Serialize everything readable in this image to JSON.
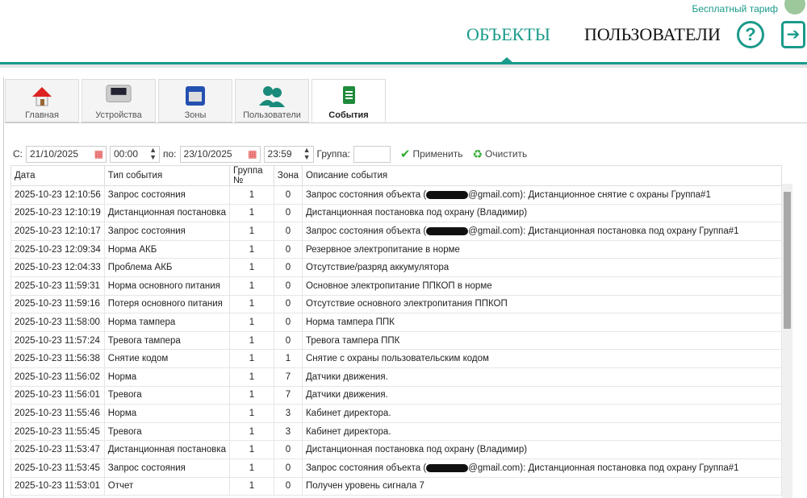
{
  "header": {
    "plan": "Бесплатный тариф",
    "nav": [
      "ОБЪЕКТЫ",
      "ПОЛЬЗОВАТЕЛИ"
    ],
    "active_nav": "ОБЪЕКТЫ",
    "accent": "#1a9a8a"
  },
  "tabs": [
    {
      "label": "Главная",
      "icon": "house-icon"
    },
    {
      "label": "Устройства",
      "icon": "device-panel-icon"
    },
    {
      "label": "Зоны",
      "icon": "zones-icon"
    },
    {
      "label": "Пользователи",
      "icon": "users-icon"
    },
    {
      "label": "События",
      "icon": "document-icon",
      "active": true
    }
  ],
  "filters": {
    "from_label": "С:",
    "from_date": "21/10/2025",
    "from_time": "00:00",
    "to_label": "по:",
    "to_date": "23/10/2025",
    "to_time": "23:59",
    "group_label": "Группа:",
    "group_value": "",
    "apply": "Применить",
    "clear": "Очистить"
  },
  "table": {
    "columns": [
      "Дата",
      "Тип события",
      "Группа №",
      "Зона",
      "Описание события"
    ],
    "rows": [
      [
        "2025-10-23 12:10:56",
        "Запрос состояния",
        "1",
        "0",
        "Запрос состояния объекта (",
        "@gmail.com): Дистанционное снятие с охраны Группа#1"
      ],
      [
        "2025-10-23 12:10:19",
        "Дистанционная постановка",
        "1",
        "0",
        "Дистанционная постановка под охрану (Владимир)",
        ""
      ],
      [
        "2025-10-23 12:10:17",
        "Запрос состояния",
        "1",
        "0",
        "Запрос состояния объекта (",
        "@gmail.com): Дистанционная постановка под охрану Группа#1"
      ],
      [
        "2025-10-23 12:09:34",
        "Норма АКБ",
        "1",
        "0",
        "Резервное электропитание в норме",
        ""
      ],
      [
        "2025-10-23 12:04:33",
        "Проблема АКБ",
        "1",
        "0",
        "Отсутствие/разряд аккумулятора",
        ""
      ],
      [
        "2025-10-23 11:59:31",
        "Норма основного питания",
        "1",
        "0",
        "Основное электропитание ППКОП в норме",
        ""
      ],
      [
        "2025-10-23 11:59:16",
        "Потеря основного питания",
        "1",
        "0",
        "Отсутствие основного электропитания ППКОП",
        ""
      ],
      [
        "2025-10-23 11:58:00",
        "Норма тампера",
        "1",
        "0",
        "Норма тампера ППК",
        ""
      ],
      [
        "2025-10-23 11:57:24",
        "Тревога тампера",
        "1",
        "0",
        "Тревога тампера ППК",
        ""
      ],
      [
        "2025-10-23 11:56:38",
        "Снятие кодом",
        "1",
        "1",
        "Снятие с охраны пользовательским кодом",
        ""
      ],
      [
        "2025-10-23 11:56:02",
        "Норма",
        "1",
        "7",
        "Датчики движения.",
        ""
      ],
      [
        "2025-10-23 11:56:01",
        "Тревога",
        "1",
        "7",
        "Датчики движения.",
        ""
      ],
      [
        "2025-10-23 11:55:46",
        "Норма",
        "1",
        "3",
        "Кабинет директора.",
        ""
      ],
      [
        "2025-10-23 11:55:45",
        "Тревога",
        "1",
        "3",
        "Кабинет директора.",
        ""
      ],
      [
        "2025-10-23 11:53:47",
        "Дистанционная постановка",
        "1",
        "0",
        "Дистанционная постановка под охрану (Владимир)",
        ""
      ],
      [
        "2025-10-23 11:53:45",
        "Запрос состояния",
        "1",
        "0",
        "Запрос состояния объекта (",
        "@gmail.com): Дистанционная постановка под охрану Группа#1"
      ],
      [
        "2025-10-23 11:53:01",
        "Отчет",
        "1",
        "0",
        "Получен уровень сигнала 7",
        ""
      ]
    ]
  }
}
